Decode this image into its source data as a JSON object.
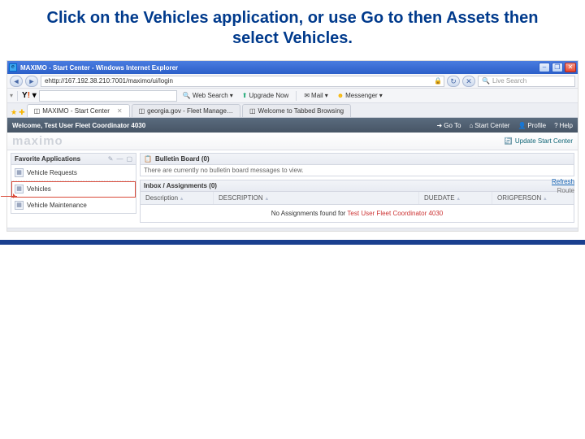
{
  "slide": {
    "title": "Click on the Vehicles application, or use Go to then Assets then select Vehicles."
  },
  "ie": {
    "window_title": "MAXIMO - Start Center - Windows Internet Explorer",
    "address": "http://167.192.38.210:7001/maximo/ui/login",
    "search_placeholder": "Live Search",
    "toolbar": {
      "web_search": "Web Search",
      "upgrade": "Upgrade Now",
      "mail": "Mail",
      "messenger": "Messenger"
    },
    "tabs": [
      {
        "label": "MAXIMO - Start Center"
      },
      {
        "label": "georgia.gov - Fleet Manage…"
      },
      {
        "label": "Welcome to Tabbed Browsing"
      }
    ]
  },
  "maximo": {
    "welcome": "Welcome, Test User Fleet Coordinator 4030",
    "links": {
      "goto": "Go To",
      "start_center": "Start Center",
      "profile": "Profile",
      "help": "Help"
    },
    "brand": "maximo",
    "update_link": "Update Start Center",
    "fav_title": "Favorite Applications",
    "fav_items": [
      "Vehicle Requests",
      "Vehicles",
      "Vehicle Maintenance"
    ],
    "bulletin_title": "Bulletin Board (0)",
    "bulletin_msg": "There are currently no bulletin board messages to view.",
    "inbox_title": "Inbox / Assignments (0)",
    "refresh": "Refresh",
    "route": "Route",
    "columns": {
      "desc": "Description",
      "descr": "DESCRIPTION",
      "due": "DUEDATE",
      "orig": "ORIGPERSON"
    },
    "no_assign_pre": "No Assignments found for ",
    "no_assign_user": "Test User Fleet Coordinator 4030"
  }
}
